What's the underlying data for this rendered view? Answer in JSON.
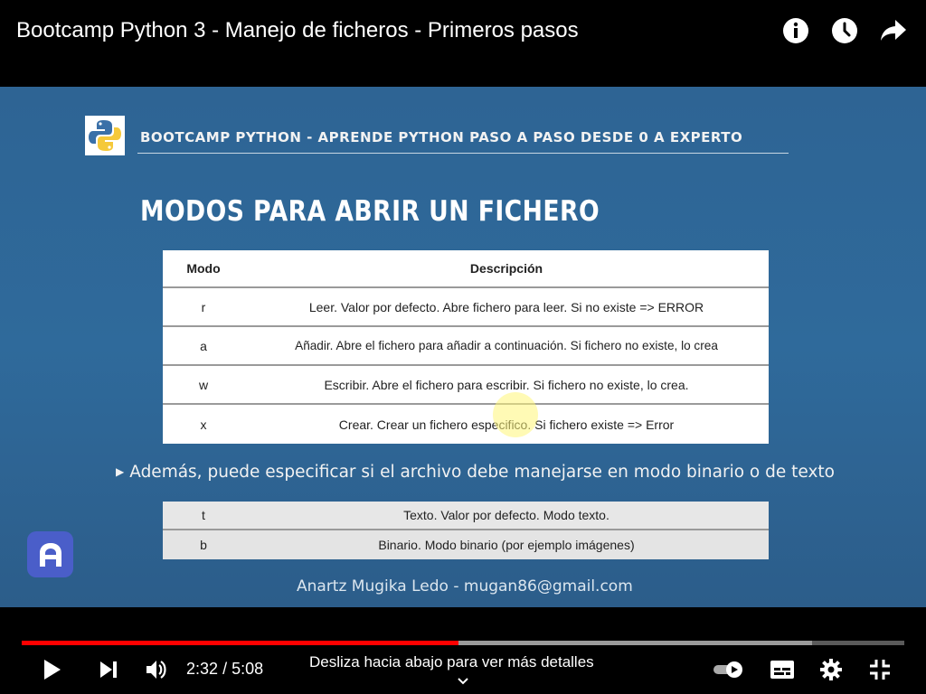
{
  "player": {
    "title": "Bootcamp Python 3 - Manejo de ficheros - Primeros pasos",
    "current_time": "2:32",
    "time_separator": "/",
    "duration": "5:08",
    "progress_fraction": 0.495,
    "buffer_fraction": 0.896,
    "hint": "Desliza hacia abajo para ver más detalles",
    "icons": [
      "info-icon",
      "clock-icon",
      "share-icon",
      "play-icon",
      "next-icon",
      "volume-icon",
      "autoplay-toggle-icon",
      "subtitles-icon",
      "settings-icon",
      "exit-fullscreen-icon",
      "chevron-down-icon"
    ],
    "accent_color": "#ff0000"
  },
  "slide": {
    "header": "BOOTCAMP PYTHON - APRENDE PYTHON PASO A PASO DESDE 0 A EXPERTO",
    "title": "MODOS PARA ABRIR UN FICHERO",
    "table_headers": [
      "Modo",
      "Descripción"
    ],
    "modes": [
      {
        "mode": "r",
        "desc": "Leer. Valor por defecto. Abre fichero para leer. Si no existe => ERROR"
      },
      {
        "mode": "a",
        "desc": "Añadir. Abre el fichero para añadir a continuación. Si fichero no existe, lo crea"
      },
      {
        "mode": "w",
        "desc": "Escribir. Abre el fichero para escribir. Si fichero no existe, lo crea."
      },
      {
        "mode": "x",
        "desc": "Crear. Crear un fichero especifico. Si fichero existe => Error"
      }
    ],
    "note": "Además, puede especificar si el archivo debe manejarse en modo binario o de texto",
    "types": [
      {
        "mode": "t",
        "desc": "Texto. Valor por defecto. Modo texto."
      },
      {
        "mode": "b",
        "desc": "Binario. Modo binario (por ejemplo imágenes)"
      }
    ],
    "author": "Anartz Mugika Ledo - mugan86@gmail.com",
    "background_color": "#2f6a9b"
  }
}
